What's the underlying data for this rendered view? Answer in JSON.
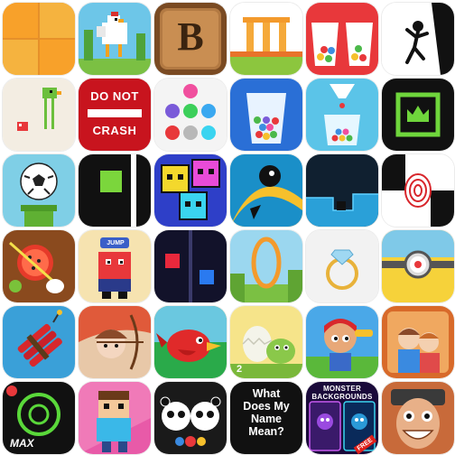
{
  "grid": {
    "rows": 6,
    "columns": 6,
    "apps": [
      {
        "icon": "orange-grid-icon"
      },
      {
        "icon": "pixel-chicken-icon"
      },
      {
        "icon": "letter-b-wooden-tile-icon",
        "label": "B"
      },
      {
        "icon": "temple-columns-icon"
      },
      {
        "icon": "cups-of-balls-icon"
      },
      {
        "icon": "stickman-silhouette-icon"
      },
      {
        "icon": "long-legged-bird-icon"
      },
      {
        "icon": "do-not-crash-sign-icon",
        "line1": "DO NOT",
        "line2": "CRASH"
      },
      {
        "icon": "colored-balls-grid-icon"
      },
      {
        "icon": "glass-of-balls-icon"
      },
      {
        "icon": "falling-balls-cup-icon"
      },
      {
        "icon": "crown-frame-icon"
      },
      {
        "icon": "soccer-ball-pipe-icon"
      },
      {
        "icon": "green-square-runner-icon"
      },
      {
        "icon": "geometry-cubes-icon"
      },
      {
        "icon": "black-ball-arc-icon"
      },
      {
        "icon": "dark-blue-steps-icon"
      },
      {
        "icon": "piano-fingerprint-icon"
      },
      {
        "icon": "fruit-slash-icon"
      },
      {
        "icon": "jump-tower-character-icon",
        "label": "JUMP"
      },
      {
        "icon": "red-blue-squares-icon"
      },
      {
        "icon": "ring-hoop-icon"
      },
      {
        "icon": "diamond-ring-icon"
      },
      {
        "icon": "minion-eye-icon"
      },
      {
        "icon": "dynamite-bundle-icon"
      },
      {
        "icon": "archer-character-icon"
      },
      {
        "icon": "red-bird-icon"
      },
      {
        "icon": "hatching-egg-dragon-icon",
        "label": "2"
      },
      {
        "icon": "cartoon-boy-hero-icon"
      },
      {
        "icon": "family-portrait-icon"
      },
      {
        "icon": "dj-max-circle-icon",
        "label": "MAX"
      },
      {
        "icon": "blocky-character-icon"
      },
      {
        "icon": "panda-juggle-icon"
      },
      {
        "icon": "name-meaning-text-icon",
        "line1": "What",
        "line2": "Does My",
        "line3": "Name",
        "line4": "Mean?"
      },
      {
        "icon": "monster-backgrounds-icon",
        "line1": "MONSTER",
        "line2": "BACKGROUNDS",
        "badge": "FREE"
      },
      {
        "icon": "grinning-face-icon"
      }
    ]
  },
  "colors": {
    "background": "#ffffff",
    "orange": "#f7a62b",
    "red_sign": "#c8141e",
    "sky": "#5bc4e8"
  }
}
